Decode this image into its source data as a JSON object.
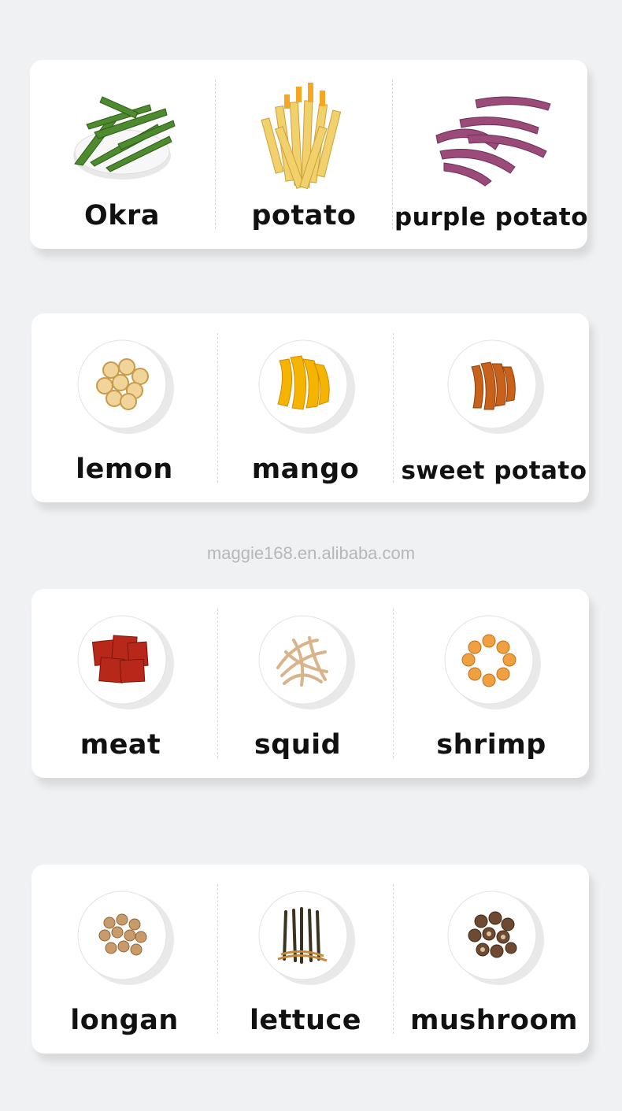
{
  "watermark": "maggie168.en.alibaba.com",
  "cards": [
    {
      "items": [
        {
          "label": "Okra",
          "icon": "okra-icon"
        },
        {
          "label": "potato",
          "icon": "potato-fries-icon"
        },
        {
          "label": "purple potato",
          "icon": "purple-potato-icon"
        }
      ]
    },
    {
      "items": [
        {
          "label": "lemon",
          "icon": "lemon-slices-icon"
        },
        {
          "label": "mango",
          "icon": "mango-icon"
        },
        {
          "label": "sweet potato",
          "icon": "sweet-potato-icon"
        }
      ]
    },
    {
      "items": [
        {
          "label": "meat",
          "icon": "meat-jerky-icon"
        },
        {
          "label": "squid",
          "icon": "squid-shreds-icon"
        },
        {
          "label": "shrimp",
          "icon": "shrimp-icon"
        }
      ]
    },
    {
      "items": [
        {
          "label": "longan",
          "icon": "longan-icon"
        },
        {
          "label": "lettuce",
          "icon": "lettuce-icon"
        },
        {
          "label": "mushroom",
          "icon": "mushroom-icon"
        }
      ]
    }
  ]
}
